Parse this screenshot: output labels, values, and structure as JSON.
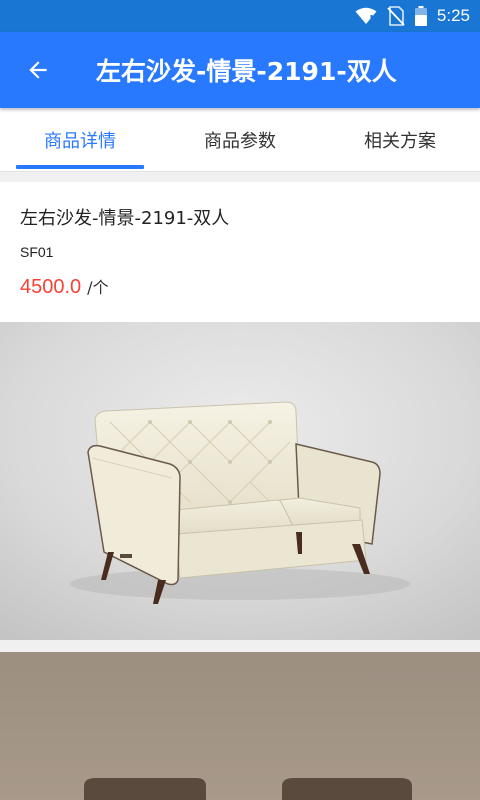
{
  "status_bar": {
    "time": "5:25",
    "icons": [
      "wifi-icon",
      "no-sim-icon",
      "battery-icon"
    ]
  },
  "header": {
    "title": "左右沙发-情景-2191-双人",
    "back_icon": "arrow-back-icon"
  },
  "tabs": [
    {
      "label": "商品详情",
      "active": true
    },
    {
      "label": "商品参数",
      "active": false
    },
    {
      "label": "相关方案",
      "active": false
    }
  ],
  "product": {
    "name": "左右沙发-情景-2191-双人",
    "code": "SF01",
    "price": "4500.0",
    "unit": "/个"
  },
  "images": [
    {
      "subject": "cream tufted loveseat sofa on grey backdrop"
    },
    {
      "subject": "dark brown sofas on taupe backdrop"
    }
  ],
  "colors": {
    "status_bar": "#1976d2",
    "app_bar": "#2979ff",
    "accent": "#2979ff",
    "price": "#f44336"
  }
}
